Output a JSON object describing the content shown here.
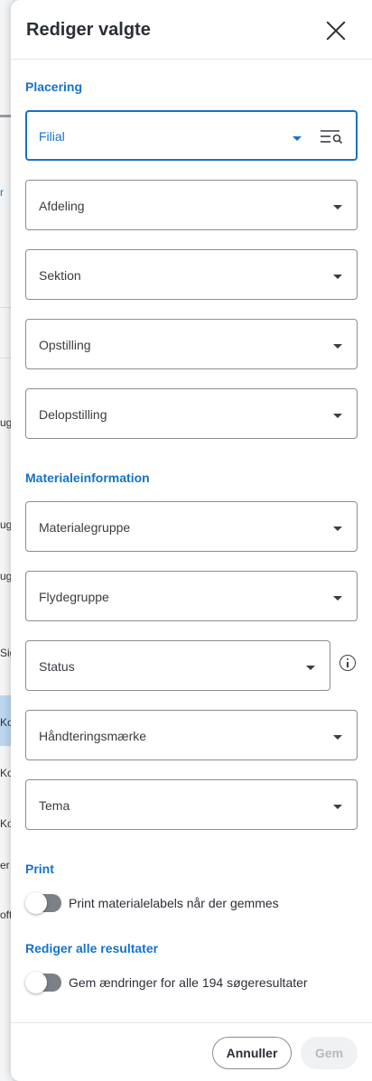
{
  "background": {
    "fragments": [
      "r",
      "ug",
      "ug",
      "ug",
      "Sig",
      "Ko",
      "Ko",
      "Ko",
      "er",
      "oft"
    ]
  },
  "panel": {
    "title": "Rediger valgte",
    "sections": {
      "placering": "Placering",
      "materialeinformation": "Materialeinformation",
      "print": "Print",
      "rediger_alle": "Rediger alle resultater"
    },
    "fields": {
      "filial": "Filial",
      "afdeling": "Afdeling",
      "sektion": "Sektion",
      "opstilling": "Opstilling",
      "delopstilling": "Delopstilling",
      "materialegruppe": "Materialegruppe",
      "flydegruppe": "Flydegruppe",
      "status": "Status",
      "haandteringsmaerke": "Håndteringsmærke",
      "tema": "Tema"
    },
    "toggles": {
      "print_labels": {
        "label": "Print materialelabels når der gemmes",
        "on": false
      },
      "edit_all": {
        "label": "Gem ændringer for alle 194 søgeresultater",
        "on": false
      }
    },
    "footer": {
      "cancel": "Annuller",
      "save": "Gem"
    }
  },
  "colors": {
    "accent": "#1473c8",
    "text": "#2b2f36",
    "border": "#8a8d93",
    "toggle_off": "#7b7f86",
    "disabled_text": "#b6b9be"
  }
}
